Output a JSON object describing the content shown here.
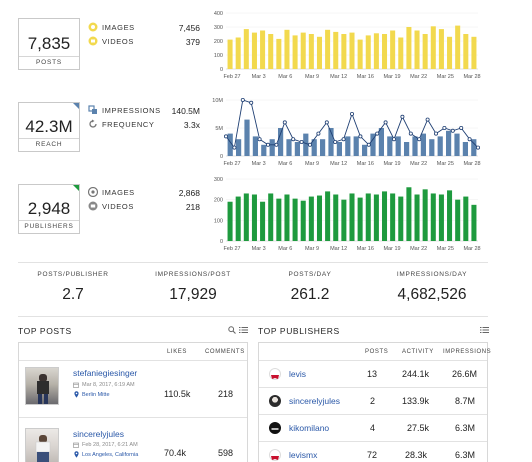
{
  "posts_card": {
    "value": "7,835",
    "label": "POSTS",
    "legend": [
      {
        "label": "IMAGES",
        "value": "7,456",
        "color": "#f2d94e"
      },
      {
        "label": "VIDEOS",
        "value": "379",
        "color": "#f2d94e"
      }
    ]
  },
  "reach_card": {
    "value": "42.3M",
    "label": "REACH",
    "accent": "#5b82ad",
    "legend": [
      {
        "label": "IMPRESSIONS",
        "value": "140.5M"
      },
      {
        "label": "FREQUENCY",
        "value": "3.3x"
      }
    ]
  },
  "publishers_card": {
    "value": "2,948",
    "label": "PUBLISHERS",
    "accent": "#1e9a3e",
    "legend": [
      {
        "label": "IMAGES",
        "value": "2,868"
      },
      {
        "label": "VIDEOS",
        "value": "218"
      }
    ]
  },
  "chart_data": [
    {
      "type": "bar",
      "color": "#f2d94e",
      "y_ticks": [
        "0",
        "100",
        "200",
        "300",
        "400"
      ],
      "ylim": [
        0,
        400
      ],
      "x_tick_labels": [
        "Feb 27",
        "Mar 3",
        "Mar 6",
        "Mar 9",
        "Mar 12",
        "Mar 16",
        "Mar 19",
        "Mar 22",
        "Mar 25",
        "Mar 28"
      ],
      "values": [
        210,
        225,
        285,
        260,
        275,
        250,
        215,
        280,
        240,
        260,
        250,
        230,
        280,
        265,
        250,
        260,
        210,
        240,
        255,
        250,
        275,
        225,
        300,
        275,
        250,
        305,
        285,
        230,
        310,
        250,
        230
      ]
    },
    {
      "type": "bar+line",
      "color": "#5b82ad",
      "line_color": "#1f3f73",
      "y_ticks": [
        "0",
        "5M",
        "10M"
      ],
      "ylim": [
        0,
        10
      ],
      "x_tick_labels": [
        "Feb 27",
        "Mar 3",
        "Mar 6",
        "Mar 9",
        "Mar 12",
        "Mar 16",
        "Mar 19",
        "Mar 22",
        "Mar 25",
        "Mar 28"
      ],
      "bars": [
        4,
        3,
        6.5,
        3.5,
        2,
        3,
        5,
        3,
        2.5,
        4,
        3,
        3,
        5,
        2.5,
        3.5,
        3.5,
        2,
        4,
        5,
        3.5,
        3.5,
        2.5,
        3.5,
        4,
        3,
        3.5,
        4.5,
        4,
        2.5,
        3
      ],
      "line": [
        3.5,
        1.5,
        10,
        9.5,
        3,
        2,
        2,
        6,
        3,
        2.5,
        2,
        4,
        6,
        2.5,
        3,
        7.5,
        3.5,
        2,
        4,
        6,
        3,
        7,
        4,
        3,
        6.5,
        4,
        5,
        4.5,
        5,
        3,
        1.5
      ]
    },
    {
      "type": "bar",
      "color": "#1e9a3e",
      "y_ticks": [
        "0",
        "100",
        "200",
        "300"
      ],
      "ylim": [
        0,
        300
      ],
      "x_tick_labels": [
        "Feb 27",
        "Mar 3",
        "Mar 6",
        "Mar 9",
        "Mar 12",
        "Mar 16",
        "Mar 19",
        "Mar 22",
        "Mar 25",
        "Mar 28"
      ],
      "values": [
        190,
        215,
        230,
        225,
        190,
        230,
        205,
        225,
        205,
        195,
        215,
        220,
        240,
        225,
        200,
        230,
        210,
        230,
        225,
        240,
        230,
        215,
        260,
        225,
        250,
        230,
        225,
        245,
        200,
        215,
        175
      ]
    }
  ],
  "metrics": [
    {
      "label": "POSTS/PUBLISHER",
      "value": "2.7"
    },
    {
      "label": "IMPRESSIONS/POST",
      "value": "17,929"
    },
    {
      "label": "POSTS/DAY",
      "value": "261.2"
    },
    {
      "label": "IMPRESSIONS/DAY",
      "value": "4,682,526"
    }
  ],
  "top_posts": {
    "title": "TOP POSTS",
    "columns": {
      "likes": "LIKES",
      "comments": "COMMENTS"
    },
    "rows": [
      {
        "user": "stefaniegiesinger",
        "date": "Mar 8, 2017, 6:19 AM",
        "location": "Berlin Mitte",
        "likes": "110.5k",
        "comments": "218"
      },
      {
        "user": "sincerelyjules",
        "date": "Feb 28, 2017, 6:21 AM",
        "location": "Los Angeles, California",
        "likes": "70.4k",
        "comments": "598"
      }
    ]
  },
  "top_publishers": {
    "title": "TOP PUBLISHERS",
    "columns": {
      "posts": "POSTS",
      "activity": "ACTIVITY",
      "impressions": "IMPRESSIONS"
    },
    "rows": [
      {
        "name": "levis",
        "posts": "13",
        "activity": "244.1k",
        "impressions": "26.6M",
        "icon_color": "#c8102e"
      },
      {
        "name": "sincerelyjules",
        "posts": "2",
        "activity": "133.9k",
        "impressions": "8.7M",
        "icon_color": "#333333"
      },
      {
        "name": "kikomilano",
        "posts": "4",
        "activity": "27.5k",
        "impressions": "6.3M",
        "icon_color": "#111111"
      },
      {
        "name": "levismx",
        "posts": "72",
        "activity": "28.3k",
        "impressions": "6.3M",
        "icon_color": "#c8102e"
      }
    ]
  }
}
